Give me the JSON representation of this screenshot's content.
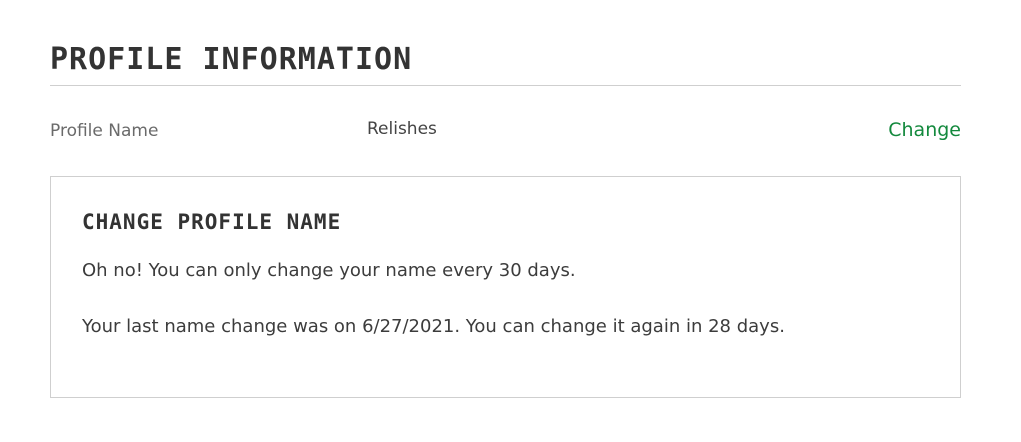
{
  "profile_information": {
    "title": "PROFILE INFORMATION",
    "profile_name_label": "Profile Name",
    "profile_name_value": "Relishes",
    "change_link": "Change"
  },
  "change_profile_name": {
    "title": "CHANGE PROFILE NAME",
    "message_1": "Oh no! You can only change your name every 30 days.",
    "message_2": "Your last name change was on 6/27/2021. You can change it again in 28 days."
  },
  "colors": {
    "link_green": "#13893d",
    "text_dark": "#333333",
    "border": "#cfcfcf"
  }
}
